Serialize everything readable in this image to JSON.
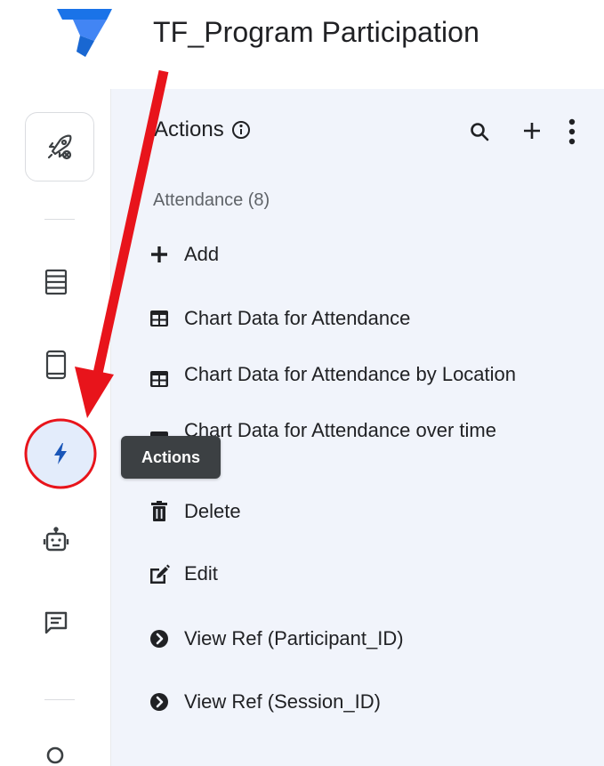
{
  "header": {
    "app_title": "TF_Program Participation",
    "logo_icon": "appsheet-logo-icon",
    "brand_color": "#1a73e8"
  },
  "rail": {
    "items": [
      {
        "icon": "launch-rocket-icon"
      },
      {
        "icon": "table-data-icon"
      },
      {
        "icon": "mobile-views-icon"
      },
      {
        "icon": "lightning-actions-icon",
        "active": true
      },
      {
        "icon": "robot-automation-icon"
      },
      {
        "icon": "chat-message-icon"
      },
      {
        "icon": "search-icon"
      }
    ],
    "active_color": "#e3ecfb"
  },
  "panel": {
    "title": "Actions",
    "group_label": "Attendance (8)",
    "items": [
      {
        "label": "Add",
        "icon": "plus-icon"
      },
      {
        "label": "Chart Data for Attendance",
        "icon": "table-grid-icon"
      },
      {
        "label": "Chart Data for Attendance by Location",
        "icon": "table-grid-icon"
      },
      {
        "label": "Chart Data for Attendance over time",
        "icon": "table-grid-icon"
      },
      {
        "label": "Delete",
        "icon": "trash-icon"
      },
      {
        "label": "Edit",
        "icon": "edit-icon"
      },
      {
        "label": "View Ref (Participant_ID)",
        "icon": "chevron-circle-icon"
      },
      {
        "label": "View Ref (Session_ID)",
        "icon": "chevron-circle-icon"
      }
    ],
    "background": "#f1f4fb"
  },
  "tooltip": {
    "text": "Actions"
  },
  "annotation": {
    "color": "#e8141b"
  }
}
